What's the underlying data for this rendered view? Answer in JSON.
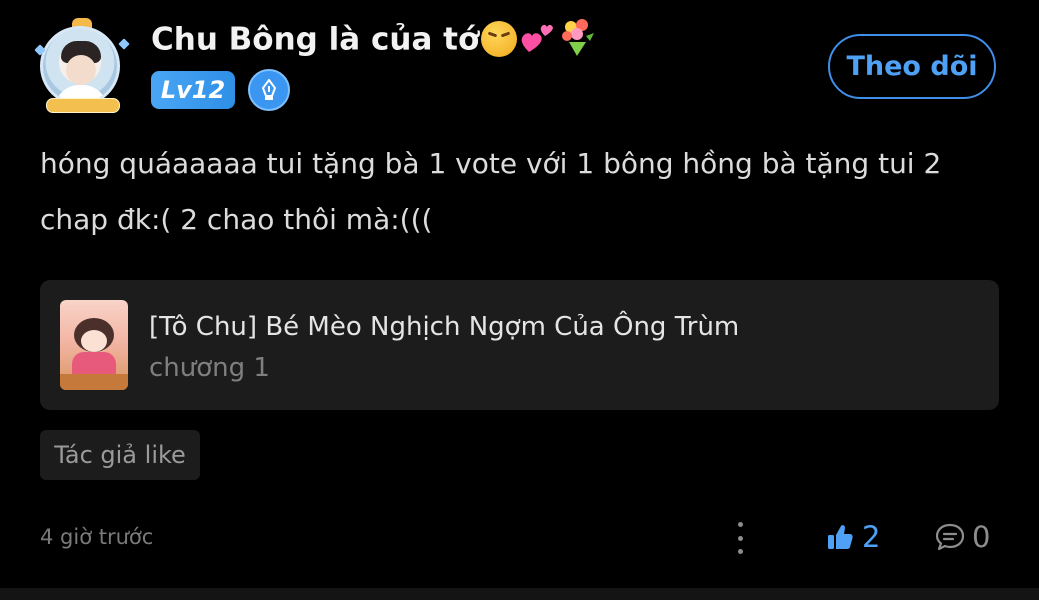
{
  "user": {
    "name": "Chu Bông là của tớ",
    "level": "Lv12",
    "emojis": [
      "confounded-face-emoji",
      "two-hearts-emoji",
      "bouquet-emoji"
    ]
  },
  "follow_button": {
    "label": "Theo dõi"
  },
  "comment": {
    "text": "hóng quáaaaaa tui tặng bà 1 vote với 1 bông hồng bà tặng tui 2 chap đk:( 2 chao thôi mà:((("
  },
  "story": {
    "title": "[Tô Chu] Bé Mèo Nghịch Ngợm Của Ông Trùm",
    "chapter": "chương 1"
  },
  "author_like": {
    "label": "Tác giả like"
  },
  "footer": {
    "timestamp": "4 giờ trước",
    "like_count": "2",
    "comment_count": "0"
  },
  "colors": {
    "background": "#000000",
    "accent": "#4ea1f5",
    "card": "#1c1c1c",
    "muted_text": "#7a7a7a"
  }
}
